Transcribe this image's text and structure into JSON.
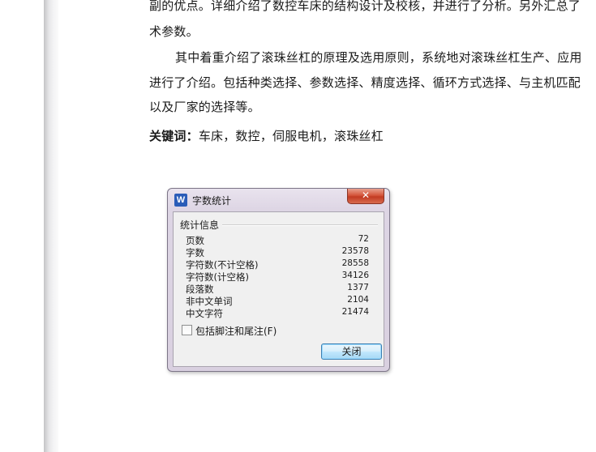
{
  "document": {
    "lines": [
      "副的优点。详细介绍了数控车床的结构设计及校核，并进行了分析。另外汇总了",
      "术参数。",
      "其中着重介绍了滚珠丝杠的原理及选用原则，系统地对滚珠丝杠生产、应用",
      "进行了介绍。包括种类选择、参数选择、精度选择、循环方式选择、与主机匹配",
      "以及厂家的选择等。"
    ],
    "keywords_label": "关键词：",
    "keywords": "车床，数控，伺服电机，滚珠丝杠"
  },
  "dialog": {
    "app_icon": "W",
    "title": "字数统计",
    "close_glyph": "✕",
    "group_title": "统计信息",
    "stats": [
      {
        "label": "页数",
        "value": "72"
      },
      {
        "label": "字数",
        "value": "23578"
      },
      {
        "label": "字符数(不计空格)",
        "value": "28558"
      },
      {
        "label": "字符数(计空格)",
        "value": "34126"
      },
      {
        "label": "段落数",
        "value": "1377"
      },
      {
        "label": "非中文单词",
        "value": "2104"
      },
      {
        "label": "中文字符",
        "value": "21474"
      }
    ],
    "checkbox_label": "包括脚注和尾注(F)",
    "checkbox_checked": false,
    "close_button_label": "关闭"
  },
  "icons": {
    "app": "wps-writer-icon",
    "close": "close-icon",
    "checkbox": "checkbox-icon"
  },
  "colors": {
    "close_red": "#c23b22",
    "button_border": "#3c7fb1",
    "app_icon_blue": "#2a5db8"
  }
}
